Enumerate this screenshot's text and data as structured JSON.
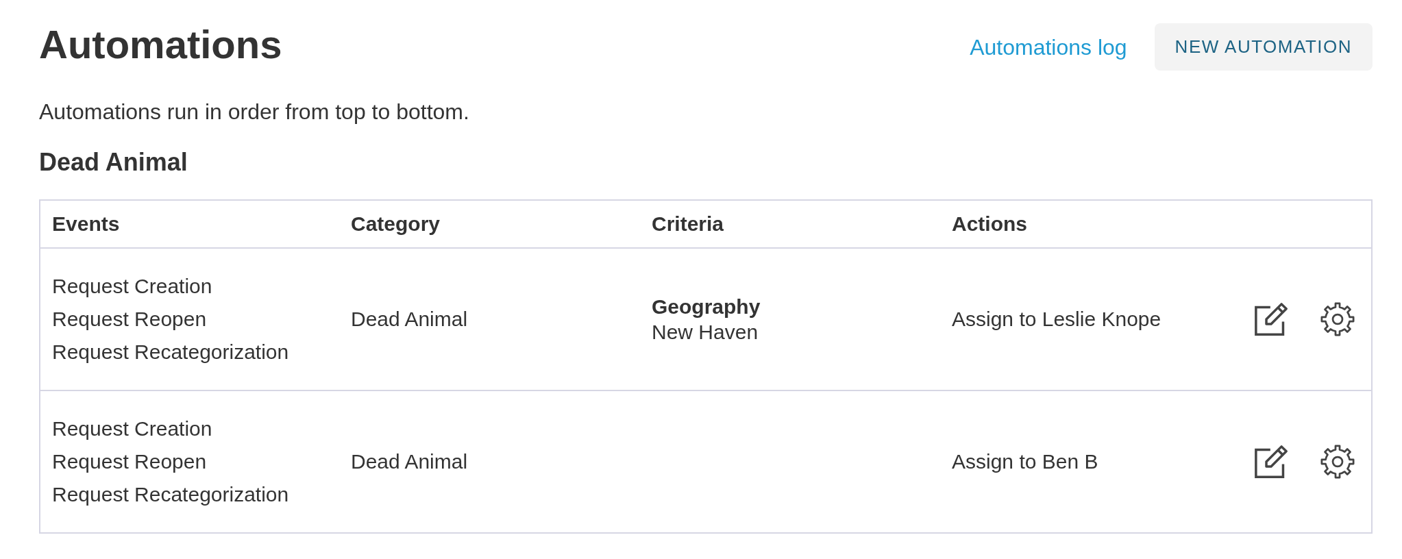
{
  "header": {
    "title": "Automations",
    "log_link": "Automations log",
    "new_button": "NEW AUTOMATION"
  },
  "description": "Automations run in order from top to bottom.",
  "groups": [
    {
      "heading": "Dead Animal",
      "table": {
        "columns": [
          "Events",
          "Category",
          "Criteria",
          "Actions"
        ],
        "rows": [
          {
            "events": [
              "Request Creation",
              "Request Reopen",
              "Request Recategorization"
            ],
            "category": "Dead Animal",
            "criteria": [
              {
                "label": "Geography",
                "value": "New Haven"
              }
            ],
            "action": "Assign to Leslie Knope"
          },
          {
            "events": [
              "Request Creation",
              "Request Reopen",
              "Request Recategorization"
            ],
            "category": "Dead Animal",
            "action": "Assign to Ben B"
          }
        ]
      }
    }
  ]
}
